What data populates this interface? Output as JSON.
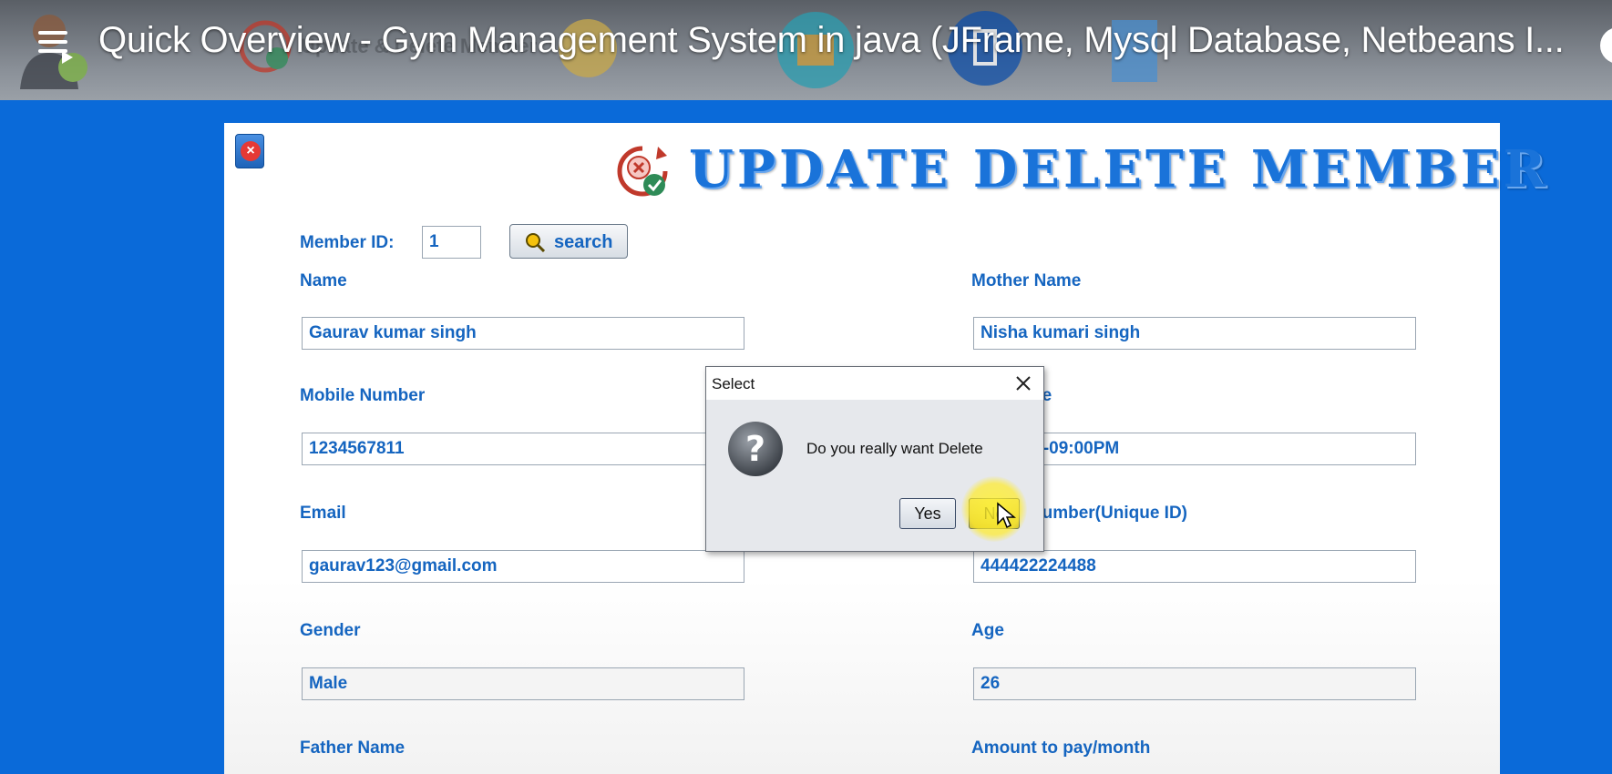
{
  "video": {
    "title": "Quick Overview - Gym Management System in java (JFrame, Mysql Database, Netbeans I..."
  },
  "frame": {
    "page_title": "UPDATE DELETE MEMBER",
    "member_id_label": "Member ID:",
    "member_id_value": "1",
    "search_label": "search",
    "fields": {
      "name": {
        "label": "Name",
        "value": "Gaurav kumar singh"
      },
      "mother_name": {
        "label": "Mother Name",
        "value": "Nisha kumari singh"
      },
      "mobile": {
        "label": "Mobile Number",
        "value": "1234567811"
      },
      "gym_time": {
        "label": "ne",
        "value": "M-09:00PM"
      },
      "email": {
        "label": "Email",
        "value": "gaurav123@gmail.com"
      },
      "aadhar": {
        "label": "number(Unique ID)",
        "value": "444422224488"
      },
      "gender": {
        "label": "Gender",
        "value": "Male"
      },
      "age": {
        "label": "Age",
        "value": "26"
      },
      "father_name": {
        "label": "Father Name"
      },
      "amount": {
        "label": "Amount to pay/month"
      }
    }
  },
  "dialog": {
    "title": "Select",
    "message": "Do you really want Delete",
    "yes_label": "Yes",
    "no_label": "No"
  },
  "colors": {
    "background": "#0a6ad9",
    "label": "#1565c0",
    "title": "#1a73d9",
    "cursor_highlight": "#fff232"
  }
}
